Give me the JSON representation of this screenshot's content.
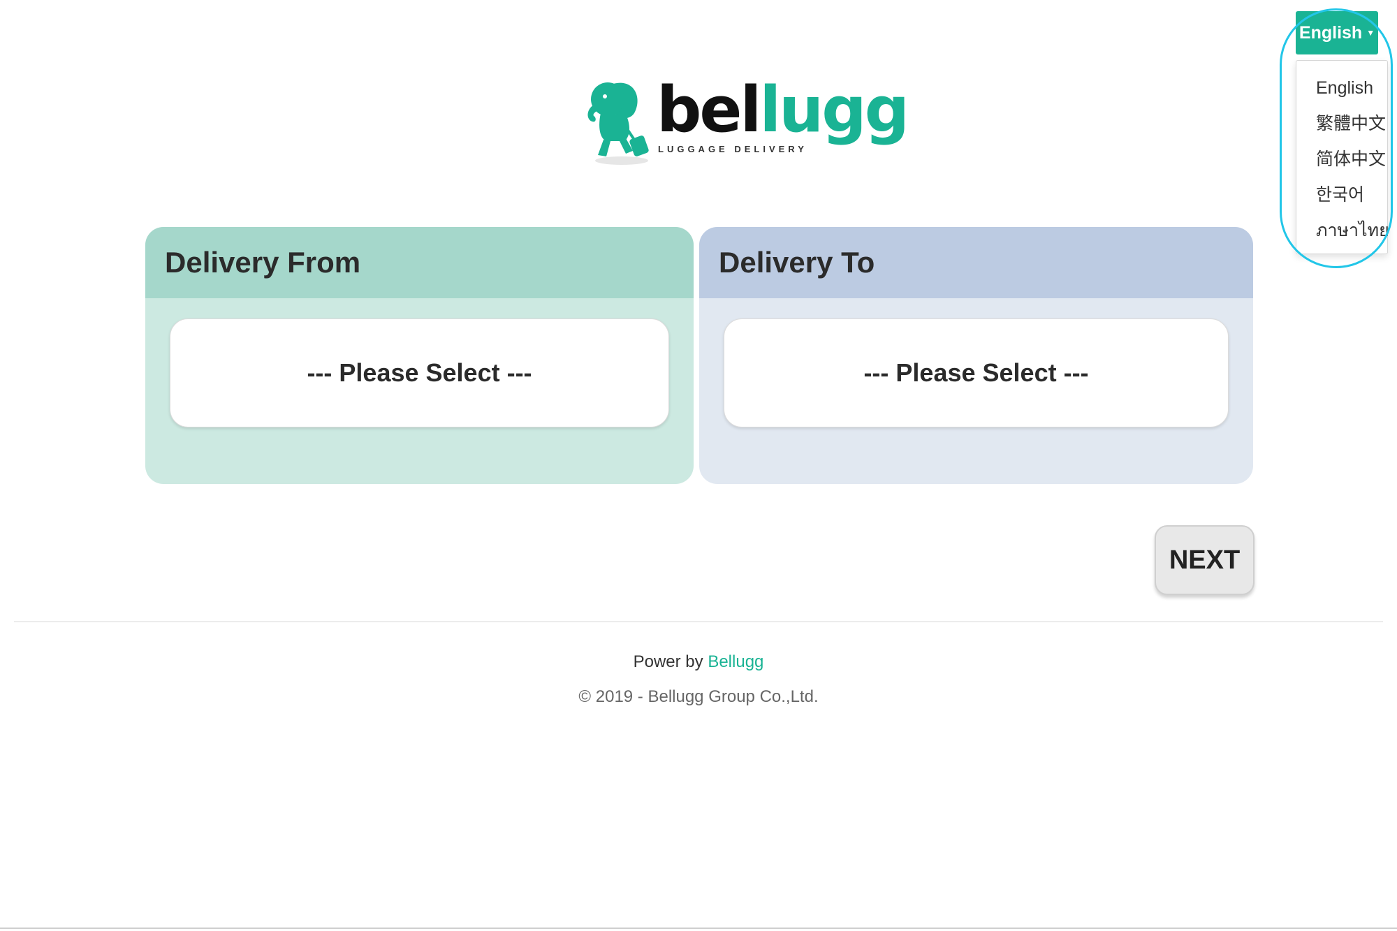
{
  "language": {
    "current": "English",
    "options": [
      "English",
      "繁體中文",
      "简体中文",
      "한국어",
      "ภาษาไทย"
    ]
  },
  "logo": {
    "word_part1": "bel",
    "word_part2": "lugg",
    "tagline": "LUGGAGE DELIVERY"
  },
  "delivery_from": {
    "title": "Delivery From",
    "select_placeholder": "--- Please Select ---"
  },
  "delivery_to": {
    "title": "Delivery To",
    "select_placeholder": "--- Please Select ---"
  },
  "actions": {
    "next_label": "NEXT"
  },
  "footer": {
    "power_prefix": "Power by",
    "power_brand": "Bellugg",
    "copyright": "© 2019 - Bellugg Group Co.,Ltd."
  },
  "colors": {
    "brand": "#1ab394",
    "from_header": "#a5d7cb",
    "from_body": "#cce9e1",
    "to_header": "#bccbe2",
    "to_body": "#e1e8f1",
    "highlight": "#22c6e8"
  }
}
